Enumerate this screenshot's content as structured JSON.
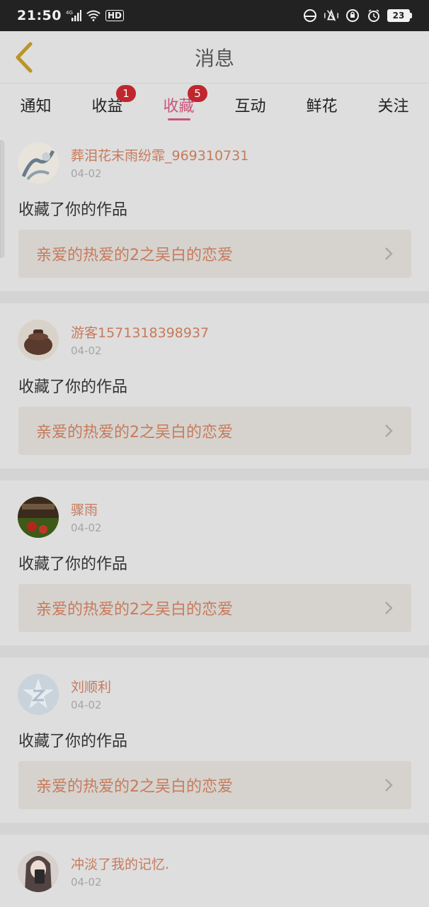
{
  "status_bar": {
    "time": "21:50",
    "network_label": "4G",
    "hd_label": "HD",
    "battery": "23"
  },
  "header": {
    "title": "消息",
    "back_icon": "chevron-left-icon"
  },
  "tabs": [
    {
      "label": "通知",
      "active": false,
      "badge": ""
    },
    {
      "label": "收益",
      "active": false,
      "badge": "1"
    },
    {
      "label": "收藏",
      "active": true,
      "badge": "5"
    },
    {
      "label": "互动",
      "active": false,
      "badge": ""
    },
    {
      "label": "鲜花",
      "active": false,
      "badge": ""
    },
    {
      "label": "关注",
      "active": false,
      "badge": ""
    }
  ],
  "messages": [
    {
      "username": "葬泪花末雨纷霏_969310731",
      "date": "04-02",
      "action": "收藏了你的作品",
      "work_title": "亲爱的热爱的2之吴白的恋爱"
    },
    {
      "username": "游客1571318398937",
      "date": "04-02",
      "action": "收藏了你的作品",
      "work_title": "亲爱的热爱的2之吴白的恋爱"
    },
    {
      "username": "骤雨",
      "date": "04-02",
      "action": "收藏了你的作品",
      "work_title": "亲爱的热爱的2之吴白的恋爱"
    },
    {
      "username": "刘顺利",
      "date": "04-02",
      "action": "收藏了你的作品",
      "work_title": "亲爱的热爱的2之吴白的恋爱"
    },
    {
      "username": "冲淡了我的记忆.",
      "date": "04-02",
      "action": "",
      "work_title": ""
    }
  ],
  "colors": {
    "accent": "#c8557a",
    "badge": "#c0262e",
    "username": "#c77a5c"
  }
}
